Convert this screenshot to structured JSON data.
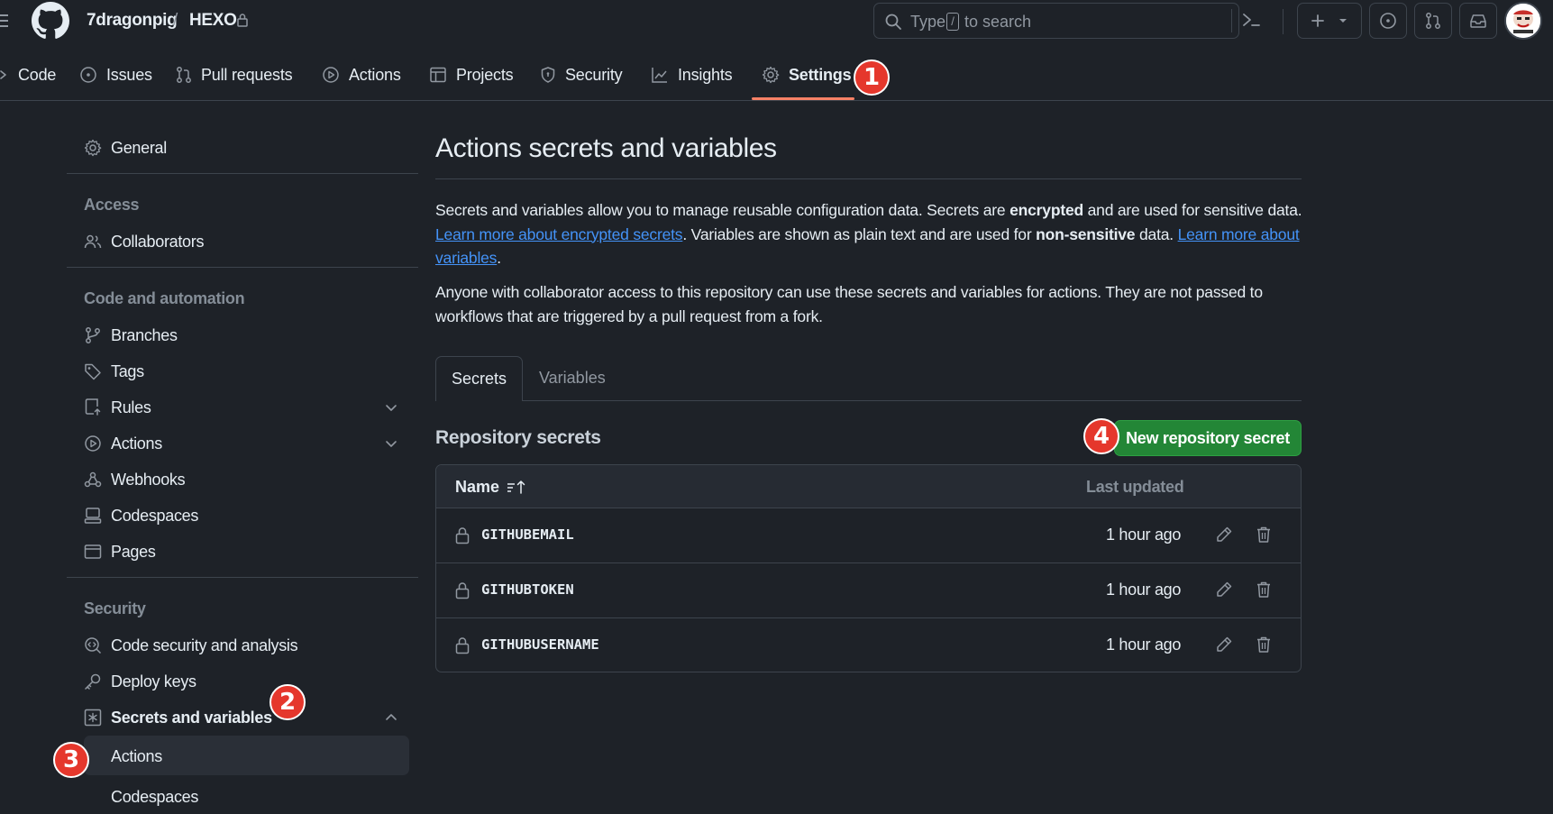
{
  "header": {
    "repo_owner": "7dragonpig",
    "repo_separator": "/",
    "repo_name": "HEXO",
    "search_prefix": "Type",
    "search_key": "/",
    "search_suffix": "to search"
  },
  "repo_nav": [
    {
      "label": "Code",
      "icon": "code-icon"
    },
    {
      "label": "Issues",
      "icon": "issue-icon"
    },
    {
      "label": "Pull requests",
      "icon": "pull-request-icon"
    },
    {
      "label": "Actions",
      "icon": "play-icon"
    },
    {
      "label": "Projects",
      "icon": "table-icon"
    },
    {
      "label": "Security",
      "icon": "shield-icon"
    },
    {
      "label": "Insights",
      "icon": "graph-icon"
    },
    {
      "label": "Settings",
      "icon": "gear-icon",
      "active": true
    }
  ],
  "markers": [
    "1",
    "2",
    "3",
    "4"
  ],
  "sidebar": {
    "general": "General",
    "access_heading": "Access",
    "collaborators": "Collaborators",
    "code_heading": "Code and automation",
    "code_items": [
      "Branches",
      "Tags",
      "Rules",
      "Actions",
      "Webhooks",
      "Codespaces",
      "Pages"
    ],
    "security_heading": "Security",
    "security_items": [
      "Code security and analysis",
      "Deploy keys",
      "Secrets and variables"
    ],
    "sub_items": [
      "Actions",
      "Codespaces"
    ]
  },
  "main": {
    "title": "Actions secrets and variables",
    "p1_a": "Secrets and variables allow you to manage reusable configuration data. Secrets are ",
    "p1_b": "encrypted",
    "p1_c": " and are used for sensitive data. ",
    "p1_link1": "Learn more about encrypted secrets",
    "p1_d": ". Variables are shown as plain text and are used for ",
    "p1_e": "non-sensitive",
    "p1_f": " data. ",
    "p1_link2": "Learn more about variables",
    "p1_g": ".",
    "p2": "Anyone with collaborator access to this repository can use these secrets and variables for actions. They are not passed to workflows that are triggered by a pull request from a fork.",
    "tabs": [
      "Secrets",
      "Variables"
    ],
    "section_title": "Repository secrets",
    "new_button": "New repository secret",
    "table_headers": {
      "name": "Name",
      "updated": "Last updated"
    },
    "secrets": [
      {
        "name": "GITHUBEMAIL",
        "updated": "1 hour ago"
      },
      {
        "name": "GITHUBTOKEN",
        "updated": "1 hour ago"
      },
      {
        "name": "GITHUBUSERNAME",
        "updated": "1 hour ago"
      }
    ]
  },
  "colors": {
    "background": "#1e2228",
    "border": "#3d444d",
    "link": "#4493f8",
    "primary_button": "#238636",
    "active_underline": "#f78166",
    "marker": "#e5372c"
  }
}
